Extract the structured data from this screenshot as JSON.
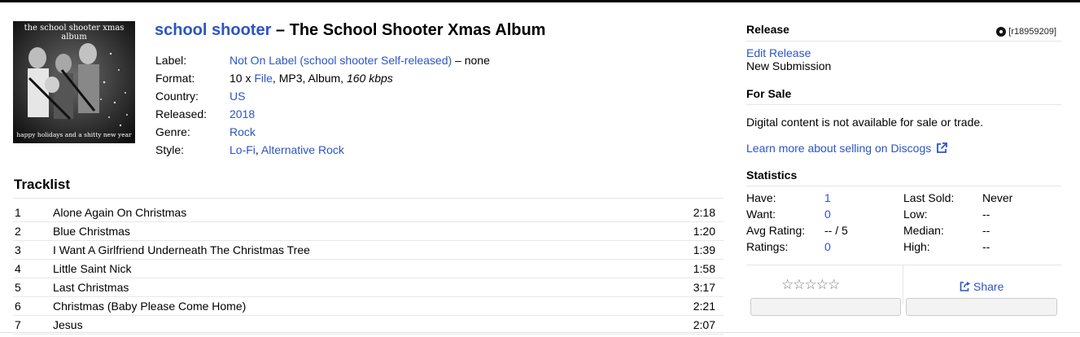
{
  "cover": {
    "top_text": "the school shooter xmas album",
    "bottom_text": "happy holidays and a shitty new year"
  },
  "release": {
    "artist": "school shooter",
    "separator": " – ",
    "title": "The School Shooter Xmas Album"
  },
  "info": {
    "label_key": "Label:",
    "label_value": "Not On Label (school shooter Self-released)",
    "label_suffix": " – none",
    "format_key": "Format:",
    "format_prefix": "10 x ",
    "format_link": "File",
    "format_mid": ", MP3, Album, ",
    "format_bitrate": "160 kbps",
    "country_key": "Country:",
    "country_value": "US",
    "released_key": "Released:",
    "released_value": "2018",
    "genre_key": "Genre:",
    "genre_value": "Rock",
    "style_key": "Style:",
    "style_1": "Lo-Fi",
    "style_sep": ", ",
    "style_2": "Alternative Rock"
  },
  "tracklist": {
    "heading": "Tracklist",
    "tracks": [
      {
        "pos": "1",
        "title": "Alone Again On Christmas",
        "duration": "2:18"
      },
      {
        "pos": "2",
        "title": "Blue Christmas",
        "duration": "1:20"
      },
      {
        "pos": "3",
        "title": "I Want A Girlfriend Underneath The Christmas Tree",
        "duration": "1:39"
      },
      {
        "pos": "4",
        "title": "Little Saint Nick",
        "duration": "1:58"
      },
      {
        "pos": "5",
        "title": "Last Christmas",
        "duration": "3:17"
      },
      {
        "pos": "6",
        "title": "Christmas (Baby Please Come Home)",
        "duration": "2:21"
      },
      {
        "pos": "7",
        "title": "Jesus",
        "duration": "2:07"
      }
    ]
  },
  "sidebar": {
    "release_heading": "Release",
    "release_id": "[r18959209]",
    "edit_release": "Edit Release",
    "new_submission": "New Submission",
    "for_sale_heading": "For Sale",
    "not_available": "Digital content is not available for sale or trade.",
    "learn_more": "Learn more about selling on Discogs",
    "statistics_heading": "Statistics",
    "stats": {
      "have_label": "Have:",
      "have_value": "1",
      "want_label": "Want:",
      "want_value": "0",
      "avg_label": "Avg Rating:",
      "avg_value": "-- / 5",
      "ratings_label": "Ratings:",
      "ratings_value": "0",
      "last_sold_label": "Last Sold:",
      "last_sold_value": "Never",
      "low_label": "Low:",
      "low_value": "--",
      "median_label": "Median:",
      "median_value": "--",
      "high_label": "High:",
      "high_value": "--"
    },
    "stars": "☆☆☆☆☆",
    "share": "Share"
  },
  "icons": {
    "disc": "disc-icon",
    "external": "external-link-icon",
    "share": "share-icon"
  },
  "colors": {
    "link": "#2b55c5",
    "rule": "#e5e5e5"
  }
}
